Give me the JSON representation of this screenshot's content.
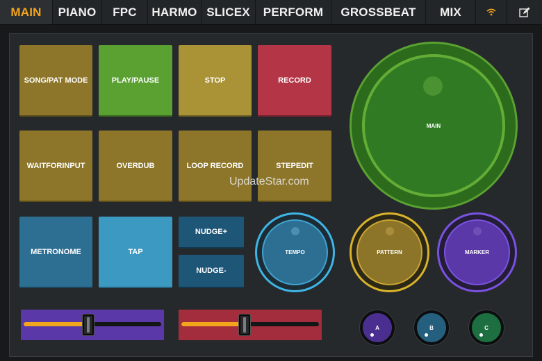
{
  "tabs": [
    {
      "label": "MAIN",
      "active": true
    },
    {
      "label": "PIANO",
      "active": false
    },
    {
      "label": "FPC",
      "active": false
    },
    {
      "label": "HARMO",
      "active": false
    },
    {
      "label": "SLICEX",
      "active": false
    },
    {
      "label": "PERFORM",
      "active": false
    },
    {
      "label": "GROSSBEAT",
      "active": false
    },
    {
      "label": "MIX",
      "active": false
    }
  ],
  "toolbar": {
    "wifi_icon": "wifi-icon",
    "edit_icon": "edit-icon"
  },
  "pads": {
    "song_pat_mode": "SONG/PAT MODE",
    "play_pause": "PLAY/PAUSE",
    "stop": "STOP",
    "record": "RECORD",
    "waitforinput": "WAITFORINPUT",
    "overdub": "OVERDUB",
    "loop_record": "LOOP RECORD",
    "stepedit": "STEPEDIT",
    "metronome": "METRONOME",
    "tap": "TAP",
    "nudge_plus": "NUDGE+",
    "nudge_minus": "NUDGE-"
  },
  "knobs": {
    "main": "MAIN",
    "tempo": "TEMPO",
    "pattern": "PATTERN",
    "marker": "MARKER"
  },
  "mini_knobs": {
    "a": "A",
    "b": "B",
    "c": "C"
  },
  "sliders": {
    "left": {
      "value": 0.47,
      "color": "#5a38a8"
    },
    "right": {
      "value": 0.46,
      "color": "#a32d3c"
    }
  },
  "colors": {
    "accent": "#f3a51c",
    "main_knob": "#5aa132",
    "tempo_ring": "#3fb5e6",
    "pattern_ring": "#d9b32a",
    "marker_ring": "#7a52e0"
  },
  "watermark": "UpdateStar.com"
}
